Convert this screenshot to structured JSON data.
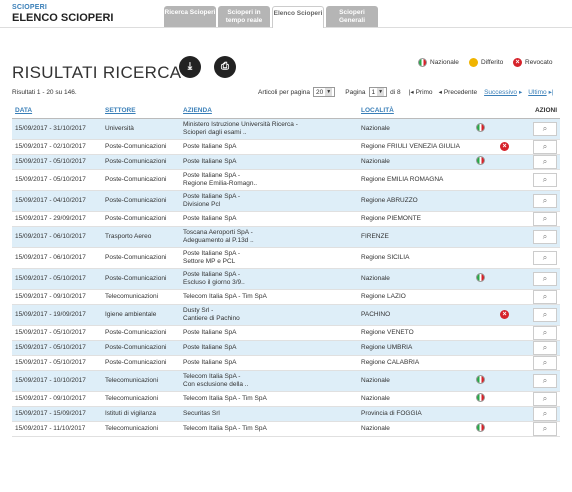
{
  "header": {
    "small": "SCIOPERI",
    "title": "ELENCO SCIOPERI"
  },
  "tabs": [
    {
      "label": "Ricerca Scioperi"
    },
    {
      "label": "Scioperi in tempo reale"
    },
    {
      "label": "Elenco Scioperi"
    },
    {
      "label": "Scioperi Generali"
    }
  ],
  "page_title": "RISULTATI RICERCA",
  "icons": {
    "export": "export-icon",
    "print": "print-icon"
  },
  "legend": {
    "nazionale": "Nazionale",
    "differito": "Differito",
    "revocato": "Revocato"
  },
  "results_text": "Risultati 1 - 20 su 146.",
  "pager": {
    "per_page_label": "Articoli per pagina",
    "per_page_value": "20",
    "page_label": "Pagina",
    "page_value": "1",
    "of_label": "di 8",
    "first": "Primo",
    "prev": "Precedente",
    "next": "Successivo",
    "last": "Ultimo"
  },
  "columns": {
    "data": "DATA",
    "settore": "SETTORE",
    "azienda": "AZIENDA",
    "localita": "LOCALITÀ",
    "azioni": "AZIONI"
  },
  "rows": [
    {
      "data": "15/09/2017 - 31/10/2017",
      "settore": "Università",
      "azienda": "Ministero Istruzione Università Ricerca -\nScioperi dagli esami ..",
      "localita": "Nazionale",
      "flag": "naz"
    },
    {
      "data": "15/09/2017 - 02/10/2017",
      "settore": "Poste-Comunicazioni",
      "azienda": "Poste Italiane SpA",
      "localita": "Regione FRIULI VENEZIA GIULIA",
      "flag": "rev"
    },
    {
      "data": "15/09/2017 - 05/10/2017",
      "settore": "Poste-Comunicazioni",
      "azienda": "Poste Italiane SpA",
      "localita": "Nazionale",
      "flag": "naz"
    },
    {
      "data": "15/09/2017 - 05/10/2017",
      "settore": "Poste-Comunicazioni",
      "azienda": "Poste Italiane SpA -\nRegione Emilia-Romagn..",
      "localita": "Regione EMILIA ROMAGNA",
      "flag": ""
    },
    {
      "data": "15/09/2017 - 04/10/2017",
      "settore": "Poste-Comunicazioni",
      "azienda": "Poste Italiane SpA -\nDivisione Pcl",
      "localita": "Regione ABRUZZO",
      "flag": ""
    },
    {
      "data": "15/09/2017 - 29/09/2017",
      "settore": "Poste-Comunicazioni",
      "azienda": "Poste Italiane SpA",
      "localita": "Regione PIEMONTE",
      "flag": ""
    },
    {
      "data": "15/09/2017 - 06/10/2017",
      "settore": "Trasporto Aereo",
      "azienda": "Toscana Aeroporti SpA -\nAdeguamento al P.13d ..",
      "localita": "FIRENZE",
      "flag": ""
    },
    {
      "data": "15/09/2017 - 06/10/2017",
      "settore": "Poste-Comunicazioni",
      "azienda": "Poste Italiane SpA -\nSettore MP e PCL",
      "localita": "Regione SICILIA",
      "flag": ""
    },
    {
      "data": "15/09/2017 - 05/10/2017",
      "settore": "Poste-Comunicazioni",
      "azienda": "Poste Italiane SpA -\nEscluso il giorno 3/9..",
      "localita": "Nazionale",
      "flag": "naz"
    },
    {
      "data": "15/09/2017 - 09/10/2017",
      "settore": "Telecomunicazioni",
      "azienda": "Telecom Italia SpA - Tim SpA",
      "localita": "Regione LAZIO",
      "flag": ""
    },
    {
      "data": "15/09/2017 - 19/09/2017",
      "settore": "Igiene ambientale",
      "azienda": "Dusty Srl -\nCantiere di Pachino",
      "localita": "PACHINO",
      "flag": "rev"
    },
    {
      "data": "15/09/2017 - 05/10/2017",
      "settore": "Poste-Comunicazioni",
      "azienda": "Poste Italiane SpA",
      "localita": "Regione VENETO",
      "flag": ""
    },
    {
      "data": "15/09/2017 - 05/10/2017",
      "settore": "Poste-Comunicazioni",
      "azienda": "Poste Italiane SpA",
      "localita": "Regione UMBRIA",
      "flag": ""
    },
    {
      "data": "15/09/2017 - 05/10/2017",
      "settore": "Poste-Comunicazioni",
      "azienda": "Poste Italiane SpA",
      "localita": "Regione CALABRIA",
      "flag": ""
    },
    {
      "data": "15/09/2017 - 10/10/2017",
      "settore": "Telecomunicazioni",
      "azienda": "Telecom Italia SpA -\nCon esclusione della ..",
      "localita": "Nazionale",
      "flag": "naz"
    },
    {
      "data": "15/09/2017 - 09/10/2017",
      "settore": "Telecomunicazioni",
      "azienda": "Telecom Italia SpA - Tim SpA",
      "localita": "Nazionale",
      "flag": "naz"
    },
    {
      "data": "15/09/2017 - 15/09/2017",
      "settore": "Istituti di vigilanza",
      "azienda": "Securitas Srl",
      "localita": "Provincia di FOGGIA",
      "flag": ""
    },
    {
      "data": "15/09/2017 - 11/10/2017",
      "settore": "Telecomunicazioni",
      "azienda": "Telecom Italia SpA - Tim SpA",
      "localita": "Nazionale",
      "flag": "naz"
    }
  ]
}
